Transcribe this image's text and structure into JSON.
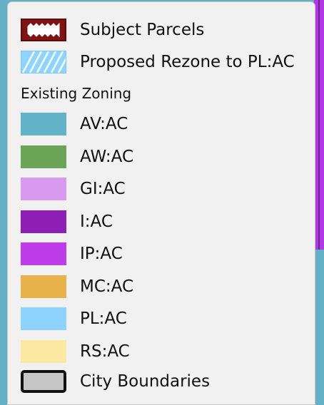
{
  "legend": {
    "items": [
      {
        "label": "Subject Parcels",
        "icon": "subject-parcels-symbol",
        "color": "#7e1414"
      },
      {
        "label": "Proposed Rezone to PL:AC",
        "icon": "hatched-rezone-symbol",
        "color": "#8fd3ff"
      }
    ],
    "section_heading": "Existing Zoning",
    "zoning": [
      {
        "label": "AV:AC",
        "color": "#62b3c8"
      },
      {
        "label": "AW:AC",
        "color": "#6aa456"
      },
      {
        "label": "GI:AC",
        "color": "#d79af0"
      },
      {
        "label": "I:AC",
        "color": "#8e1fb4"
      },
      {
        "label": "IP:AC",
        "color": "#bf3ce9"
      },
      {
        "label": "MC:AC",
        "color": "#e8b24a"
      },
      {
        "label": "PL:AC",
        "color": "#8dd3fd"
      },
      {
        "label": "RS:AC",
        "color": "#fbe9a1"
      }
    ],
    "boundary": {
      "label": "City Boundaries",
      "icon": "city-boundary-symbol",
      "color": "#c6c6c6"
    }
  }
}
